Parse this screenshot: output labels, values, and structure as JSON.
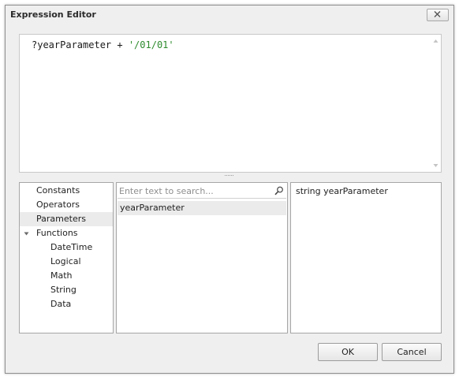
{
  "window": {
    "title": "Expression Editor"
  },
  "editor": {
    "expression_var": "?yearParameter + ",
    "expression_str": "'/01/01'"
  },
  "tree": {
    "items": [
      {
        "label": "Constants"
      },
      {
        "label": "Operators"
      },
      {
        "label": "Parameters",
        "selected": true
      },
      {
        "label": "Functions",
        "expanded": true
      },
      {
        "label": "DateTime"
      },
      {
        "label": "Logical"
      },
      {
        "label": "Math"
      },
      {
        "label": "String"
      },
      {
        "label": "Data"
      }
    ]
  },
  "search": {
    "placeholder": "Enter text to search..."
  },
  "list": {
    "items": [
      {
        "label": "yearParameter"
      }
    ]
  },
  "description": {
    "text": "string yearParameter"
  },
  "buttons": {
    "ok": "OK",
    "cancel": "Cancel"
  },
  "icons": {
    "close": "close-icon",
    "search": "search-icon",
    "expander": "triangle-down-icon"
  }
}
